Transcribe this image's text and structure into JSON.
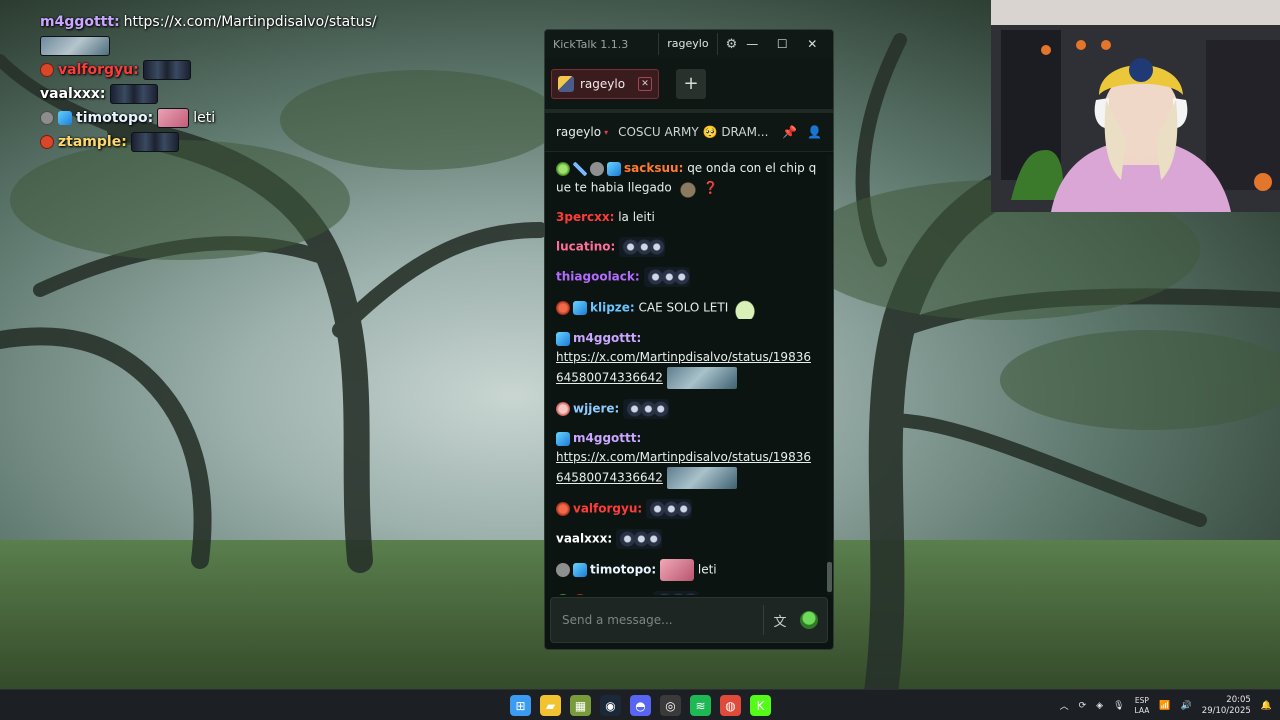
{
  "overlay_chat": [
    {
      "user": "m4ggottt:",
      "text": "https://x.com/Martinpdisalvo/status/",
      "user_color": "#c9a6ff"
    },
    {
      "user": "",
      "text": "",
      "emote": "pic"
    },
    {
      "user": "valforgyu:",
      "text": "",
      "user_color": "#ff3b3b"
    },
    {
      "user": "vaalxxx:",
      "text": "",
      "user_color": "#ffffff"
    },
    {
      "user": "timotopo:",
      "text": "leti",
      "user_color": "#e8f4ff"
    },
    {
      "user": "ztample:",
      "text": "",
      "user_color": "#ffd86b"
    }
  ],
  "window": {
    "app_title": "KickTalk 1.1.3",
    "username": "rageylo",
    "gear_icon": "⚙",
    "minimize_icon": "—",
    "maximize_icon": "☐",
    "close_icon": "✕"
  },
  "tabs": [
    {
      "label": "rageylo",
      "close_icon": "✕"
    }
  ],
  "add_tab_icon": "+",
  "chat_header": {
    "channel": "rageylo",
    "live_icon": "▾",
    "stream_title": "COSCU ARMY 🥺 DRAM...",
    "pin_icon": "📌",
    "user_icon": "👤"
  },
  "messages": [
    {
      "user": "sacksuu:",
      "user_color": "#ff7a2f",
      "badges": [
        "b-green",
        "b-sword",
        "b-grey",
        "b-cube"
      ],
      "text": " qe onda con el chip que te habia llegado",
      "extra": "deco",
      "question": "❓"
    },
    {
      "user": "3percxx:",
      "user_color": "#ff3b3b",
      "badges": [],
      "text": " la leiti"
    },
    {
      "user": "lucatino:",
      "user_color": "#ff6d9a",
      "badges": [],
      "emote": true
    },
    {
      "user": "thiagoolack:",
      "user_color": "#b36bff",
      "badges": [],
      "emote": true
    },
    {
      "user": "klipze:",
      "user_color": "#6bc3ff",
      "badges": [
        "b-red",
        "b-cube"
      ],
      "text": " CAE SOLO LETI",
      "extra": "frog"
    },
    {
      "user": "m4ggottt:",
      "user_color": "#c9a6ff",
      "badges": [
        "b-cube"
      ],
      "link": "https://x.com/Martinpdisalvo/status/1983664580074336642",
      "img": true
    },
    {
      "user": "wjjere:",
      "user_color": "#8ecbff",
      "badges": [
        "b-pink"
      ],
      "emote": true
    },
    {
      "user": "m4ggottt:",
      "user_color": "#c9a6ff",
      "badges": [
        "b-cube"
      ],
      "link": "https://x.com/Martinpdisalvo/status/1983664580074336642",
      "img": true
    },
    {
      "user": "valforgyu:",
      "user_color": "#ff3b3b",
      "badges": [
        "b-red"
      ],
      "emote": true
    },
    {
      "user": "vaalxxx:",
      "user_color": "#ffffff",
      "badges": [],
      "emote": true
    },
    {
      "user": "timotopo:",
      "user_color": "#e8f4ff",
      "badges": [
        "b-grey",
        "b-cube"
      ],
      "text": " leti",
      "pink": true
    },
    {
      "user": "ztample:",
      "user_color": "#7be05f",
      "badges": [
        "b-green",
        "b-red"
      ],
      "emote": true
    }
  ],
  "composer": {
    "placeholder": "Send a message...",
    "translate_icon": "文",
    "emoji_icon": "emoji-icon"
  },
  "taskbar": {
    "apps": [
      {
        "name": "windows-start-icon",
        "glyph": "⊞",
        "color": "#3a9bf0"
      },
      {
        "name": "file-explorer-icon",
        "glyph": "▰",
        "color": "#f2c230"
      },
      {
        "name": "store-icon",
        "glyph": "▦",
        "color": "#7a9b3b"
      },
      {
        "name": "steam-icon",
        "glyph": "◉",
        "color": "#1b2838"
      },
      {
        "name": "discord-icon",
        "glyph": "◓",
        "color": "#5865f2"
      },
      {
        "name": "obs-icon",
        "glyph": "◎",
        "color": "#3a3a3a"
      },
      {
        "name": "spotify-icon",
        "glyph": "≋",
        "color": "#1db954"
      },
      {
        "name": "chrome-icon",
        "glyph": "◍",
        "color": "#e04a3a"
      },
      {
        "name": "kicktalk-icon",
        "glyph": "K",
        "color": "#53fc18"
      }
    ],
    "tray_chevron": "︿",
    "lang_top": "ESP",
    "lang_bottom": "LAA",
    "time": "20:05",
    "date": "29/10/2025"
  }
}
